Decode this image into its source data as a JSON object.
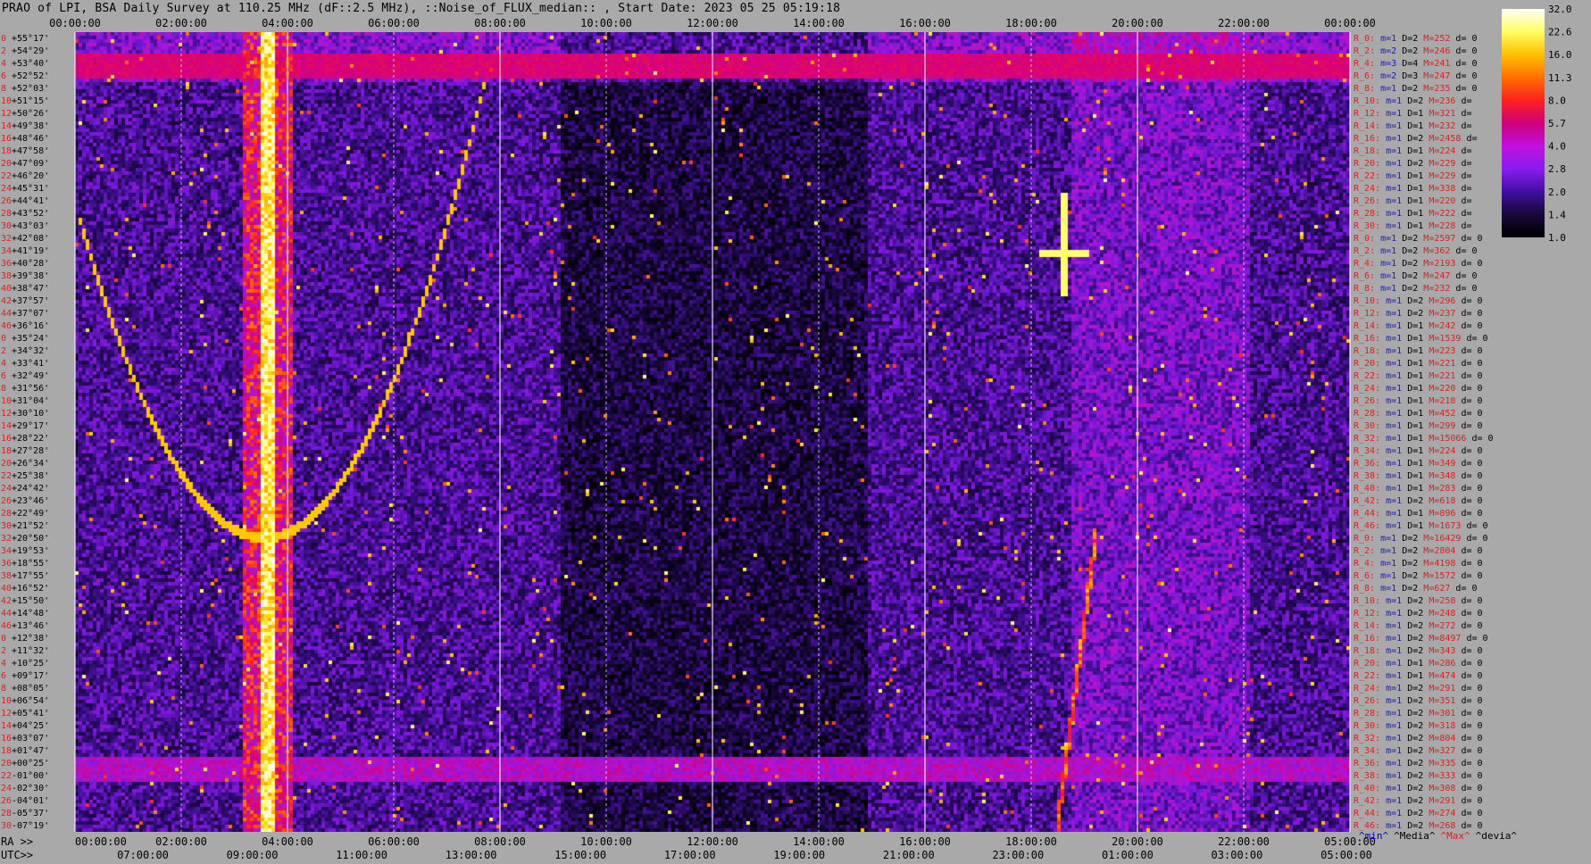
{
  "header": {
    "title": "PRAO of LPI, BSA Daily Survey at 110.25 MHz (dF::2.5 MHz), ::Noise_of_FLUX_median:: , Start Date: 2023 05 25 05:19:18"
  },
  "chart_data": {
    "type": "heatmap",
    "x_axis_top": {
      "labels": [
        "00:00:00",
        "02:00:00",
        "04:00:00",
        "06:00:00",
        "08:00:00",
        "10:00:00",
        "12:00:00",
        "14:00:00",
        "16:00:00",
        "18:00:00",
        "20:00:00",
        "22:00:00",
        "00:00:00"
      ]
    },
    "x_axis_bottom_ra": {
      "prefix": "RA >>",
      "labels": [
        "00:00:00",
        "02:00:00",
        "04:00:00",
        "06:00:00",
        "08:00:00",
        "10:00:00",
        "12:00:00",
        "14:00:00",
        "16:00:00",
        "18:00:00",
        "20:00:00",
        "22:00:00",
        "05:00:00"
      ]
    },
    "x_axis_bottom_utc": {
      "prefix": "UTC>>",
      "labels": [
        "07:00:00",
        "09:00:00",
        "11:00:00",
        "13:00:00",
        "15:00:00",
        "17:00:00",
        "19:00:00",
        "21:00:00",
        "23:00:00",
        "01:00:00",
        "03:00:00",
        "05:00:00"
      ]
    },
    "y_axis": {
      "row_indices": [
        "0",
        "2",
        "4",
        "6",
        "8",
        "10",
        "12",
        "14",
        "16",
        "18",
        "20",
        "22",
        "24",
        "26",
        "28",
        "30",
        "32",
        "34",
        "36",
        "38",
        "40",
        "42",
        "44",
        "46",
        "0",
        "2",
        "4",
        "6",
        "8",
        "10",
        "12",
        "14",
        "16",
        "18",
        "20",
        "22",
        "24",
        "26",
        "28",
        "30",
        "32",
        "34",
        "36",
        "38",
        "40",
        "42",
        "44",
        "46",
        "0",
        "2",
        "4",
        "6",
        "8",
        "10",
        "12",
        "14",
        "16",
        "18",
        "20",
        "22",
        "24",
        "26",
        "28",
        "30",
        "32",
        "34",
        "36",
        "38",
        "40",
        "42",
        "44",
        "46"
      ],
      "declinations": [
        "+55°17'",
        "+54°29'",
        "+53°40'",
        "+52°52'",
        "+52°03'",
        "+51°15'",
        "+50°26'",
        "+49°38'",
        "+48°46'",
        "+47°58'",
        "+47°09'",
        "+46°20'",
        "+45°31'",
        "+44°41'",
        "+43°52'",
        "+43°03'",
        "+42°08'",
        "+41°19'",
        "+40°28'",
        "+39°38'",
        "+38°47'",
        "+37°57'",
        "+37°07'",
        "+36°16'",
        "+35°24'",
        "+34°32'",
        "+33°41'",
        "+32°49'",
        "+31°56'",
        "+31°04'",
        "+30°10'",
        "+29°17'",
        "+28°22'",
        "+27°28'",
        "+26°34'",
        "+25°38'",
        "+24°42'",
        "+23°46'",
        "+22°49'",
        "+21°52'",
        "+20°50'",
        "+19°53'",
        "+18°55'",
        "+17°55'",
        "+16°52'",
        "+15°50'",
        "+14°48'",
        "+13°46'",
        "+12°38'",
        "+11°32'",
        "+10°25'",
        "+09°17'",
        "+08°05'",
        "+06°54'",
        "+05°41'",
        "+04°25'",
        "+03°07'",
        "+01°47'",
        "+00°25'",
        "-01°00'",
        "-02°30'",
        "-04°01'",
        "-05°37'",
        "-07°19'"
      ]
    },
    "colorbar": {
      "ticks": [
        "32.0",
        "22.6",
        "16.0",
        "11.3",
        "8.0",
        "5.7",
        "4.0",
        "2.8",
        "2.0",
        "1.4",
        "1.0"
      ],
      "scale": "log",
      "colors": [
        "#ffffff",
        "#ffff60",
        "#ffc000",
        "#ff7000",
        "#ff2020",
        "#d0007a",
        "#c010e0",
        "#8a1cf0",
        "#4010a0",
        "#180838",
        "#000000"
      ]
    },
    "right_stats": [
      [
        "R_0:",
        "m=1",
        "D=2",
        "M=252",
        "d= 0"
      ],
      [
        "R_2:",
        "m=2",
        "D=2",
        "M=246",
        "d= 0"
      ],
      [
        "R_4:",
        "m=3",
        "D=4",
        "M=241",
        "d= 0"
      ],
      [
        "R_6:",
        "m=2",
        "D=3",
        "M=247",
        "d= 0"
      ],
      [
        "R_8:",
        "m=1",
        "D=2",
        "M=235",
        "d= 0"
      ],
      [
        "R_10:",
        "m=1",
        "D=2",
        "M=236",
        "d="
      ],
      [
        "R_12:",
        "m=1",
        "D=1",
        "M=321",
        "d="
      ],
      [
        "R_14:",
        "m=1",
        "D=1",
        "M=232",
        "d="
      ],
      [
        "R_16:",
        "m=1",
        "D=2",
        "M=2458",
        "d="
      ],
      [
        "R_18:",
        "m=1",
        "D=1",
        "M=224",
        "d="
      ],
      [
        "R_20:",
        "m=1",
        "D=2",
        "M=229",
        "d="
      ],
      [
        "R_22:",
        "m=1",
        "D=1",
        "M=229",
        "d="
      ],
      [
        "R_24:",
        "m=1",
        "D=1",
        "M=338",
        "d="
      ],
      [
        "R_26:",
        "m=1",
        "D=1",
        "M=220",
        "d="
      ],
      [
        "R_28:",
        "m=1",
        "D=1",
        "M=222",
        "d="
      ],
      [
        "R_30:",
        "m=1",
        "D=1",
        "M=228",
        "d="
      ],
      [
        "R_0:",
        "m=1",
        "D=2",
        "M=2597",
        "d= 0"
      ],
      [
        "R_2:",
        "m=1",
        "D=2",
        "M=362",
        "d= 0"
      ],
      [
        "R_4:",
        "m=1",
        "D=2",
        "M=2193",
        "d= 0"
      ],
      [
        "R_6:",
        "m=1",
        "D=2",
        "M=247",
        "d= 0"
      ],
      [
        "R_8:",
        "m=1",
        "D=2",
        "M=232",
        "d= 0"
      ],
      [
        "R_10:",
        "m=1",
        "D=2",
        "M=296",
        "d= 0"
      ],
      [
        "R_12:",
        "m=1",
        "D=2",
        "M=237",
        "d= 0"
      ],
      [
        "R_14:",
        "m=1",
        "D=1",
        "M=242",
        "d= 0"
      ],
      [
        "R_16:",
        "m=1",
        "D=1",
        "M=1539",
        "d= 0"
      ],
      [
        "R_18:",
        "m=1",
        "D=1",
        "M=223",
        "d= 0"
      ],
      [
        "R_20:",
        "m=1",
        "D=1",
        "M=221",
        "d= 0"
      ],
      [
        "R_22:",
        "m=1",
        "D=1",
        "M=221",
        "d= 0"
      ],
      [
        "R_24:",
        "m=1",
        "D=1",
        "M=220",
        "d= 0"
      ],
      [
        "R_26:",
        "m=1",
        "D=1",
        "M=218",
        "d= 0"
      ],
      [
        "R_28:",
        "m=1",
        "D=1",
        "M=452",
        "d= 0"
      ],
      [
        "R_30:",
        "m=1",
        "D=1",
        "M=299",
        "d= 0"
      ],
      [
        "R_32:",
        "m=1",
        "D=1",
        "M=15066",
        "d= 0"
      ],
      [
        "R_34:",
        "m=1",
        "D=1",
        "M=224",
        "d= 0"
      ],
      [
        "R_36:",
        "m=1",
        "D=1",
        "M=349",
        "d= 0"
      ],
      [
        "R_38:",
        "m=1",
        "D=1",
        "M=348",
        "d= 0"
      ],
      [
        "R_40:",
        "m=1",
        "D=1",
        "M=283",
        "d= 0"
      ],
      [
        "R_42:",
        "m=1",
        "D=2",
        "M=618",
        "d= 0"
      ],
      [
        "R_44:",
        "m=1",
        "D=1",
        "M=896",
        "d= 0"
      ],
      [
        "R_46:",
        "m=1",
        "D=1",
        "M=1673",
        "d= 0"
      ],
      [
        "R_0:",
        "m=1",
        "D=2",
        "M=16429",
        "d= 0"
      ],
      [
        "R_2:",
        "m=1",
        "D=2",
        "M=2804",
        "d= 0"
      ],
      [
        "R_4:",
        "m=1",
        "D=2",
        "M=4198",
        "d= 0"
      ],
      [
        "R_6:",
        "m=1",
        "D=2",
        "M=1572",
        "d= 0"
      ],
      [
        "R_8:",
        "m=1",
        "D=2",
        "M=627",
        "d= 0"
      ],
      [
        "R_10:",
        "m=1",
        "D=2",
        "M=258",
        "d= 0"
      ],
      [
        "R_12:",
        "m=1",
        "D=2",
        "M=248",
        "d= 0"
      ],
      [
        "R_14:",
        "m=1",
        "D=2",
        "M=272",
        "d= 0"
      ],
      [
        "R_16:",
        "m=1",
        "D=2",
        "M=8497",
        "d= 0"
      ],
      [
        "R_18:",
        "m=1",
        "D=2",
        "M=343",
        "d= 0"
      ],
      [
        "R_20:",
        "m=1",
        "D=1",
        "M=286",
        "d= 0"
      ],
      [
        "R_22:",
        "m=1",
        "D=1",
        "M=474",
        "d= 0"
      ],
      [
        "R_24:",
        "m=1",
        "D=2",
        "M=291",
        "d= 0"
      ],
      [
        "R_26:",
        "m=1",
        "D=2",
        "M=351",
        "d= 0"
      ],
      [
        "R_28:",
        "m=1",
        "D=2",
        "M=301",
        "d= 0"
      ],
      [
        "R_30:",
        "m=1",
        "D=2",
        "M=318",
        "d= 0"
      ],
      [
        "R_32:",
        "m=1",
        "D=2",
        "M=804",
        "d= 0"
      ],
      [
        "R_34:",
        "m=1",
        "D=2",
        "M=327",
        "d= 0"
      ],
      [
        "R_36:",
        "m=1",
        "D=2",
        "M=335",
        "d= 0"
      ],
      [
        "R_38:",
        "m=1",
        "D=2",
        "M=333",
        "d= 0"
      ],
      [
        "R_40:",
        "m=1",
        "D=2",
        "M=308",
        "d= 0"
      ],
      [
        "R_42:",
        "m=1",
        "D=2",
        "M=291",
        "d= 0"
      ],
      [
        "R_44:",
        "m=1",
        "D=2",
        "M=274",
        "d= 0"
      ],
      [
        "R_46:",
        "m=1",
        "D=2",
        "M=268",
        "d= 0"
      ]
    ],
    "legend_tags": [
      "^min^",
      "^Media^",
      "^Max^",
      "^devia^"
    ]
  }
}
